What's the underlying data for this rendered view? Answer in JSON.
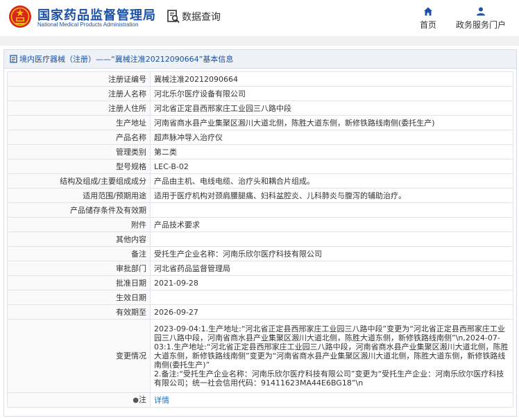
{
  "header": {
    "site_name_cn": "国家药品监督管理局",
    "site_name_en": "National Medical Products Administration",
    "query_label": "数据查询",
    "nav": {
      "home": "首页",
      "gov_service": "政务服务门户"
    }
  },
  "panel": {
    "title": "境内医疗器械（注册）——“冀械注准20212090664”基本信息"
  },
  "rows": [
    {
      "label": "注册证编号",
      "value": "冀械注准20212090664"
    },
    {
      "label": "注册人名称",
      "value": "河北乐尔医疗设备有限公司"
    },
    {
      "label": "注册人住所",
      "value": "河北省正定县西邢家庄工业园三八路中段"
    },
    {
      "label": "生产地址",
      "value": "河南省商水县产业集聚区溵川大道北侧，陈胜大道东侧，新修铁路线南侧(委托生产)"
    },
    {
      "label": "产品名称",
      "value": "超声脉冲导入治疗仪"
    },
    {
      "label": "管理类别",
      "value": "第二类"
    },
    {
      "label": "型号规格",
      "value": "LEC-B-02"
    },
    {
      "label": "结构及组成/主要组成成分",
      "value": "产品由主机、电线电缆、治疗头和耦合片组成。"
    },
    {
      "label": "适用范围/预期用途",
      "value": "适用于医疗机构对颈肩腰腿痛、妇科盆腔炎、儿科肺炎与腹泻的辅助治疗。"
    },
    {
      "label": "产品储存条件及有效期",
      "value": ""
    },
    {
      "label": "附件",
      "value": "产品技术要求"
    },
    {
      "label": "其他内容",
      "value": ""
    },
    {
      "label": "备注",
      "value": "受托生产企业名称：河南乐欣尔医疗科技有限公司"
    },
    {
      "label": "审批部门",
      "value": "河北省药品监督管理局"
    },
    {
      "label": "批准日期",
      "value": "2021-09-28"
    },
    {
      "label": "生效日期",
      "value": ""
    },
    {
      "label": "有效期至",
      "value": "2026-09-27"
    }
  ],
  "change": {
    "label": "变更情况",
    "line1": "2023-09-04:1.生产地址:“河北省正定县西邢家庄工业园三八路中段”变更为“河北省正定县西邢家庄工业园三八路中段，河南省商水县产业集聚区溵川大道北侧，陈胜大道东侧，新修铁路线南侧”\\n,2024-07-03:1.生产地址:“河北省正定县西邢家庄工业园三八路中段，河南省商水县产业集聚区溵川大道北侧，陈胜大道东侧，新修铁路线南侧”变更为“河南省商水县产业集聚区溵川大道北侧，陈胜大道东侧，新修铁路线南侧(委托生产)”",
    "line2": "2.备注:“受托生产企业名称：河南乐欣尔医疗科技有限公司”变更为“受托生产企业：河南乐欣尔医疗科技有限公司；统一社会信用代码：91411623MA44E6BG18”\\n"
  },
  "note": {
    "label": "注",
    "link": "详情"
  },
  "colors": {
    "brand_blue": "#1b52a6",
    "emblem_red": "#d7261d",
    "emblem_gold": "#f3c300",
    "link_blue": "#1b6fc4"
  },
  "icons": [
    "national-emblem-icon",
    "magnifier-document-icon",
    "home-icon",
    "user-icon",
    "document-icon",
    "pin-icon"
  ]
}
